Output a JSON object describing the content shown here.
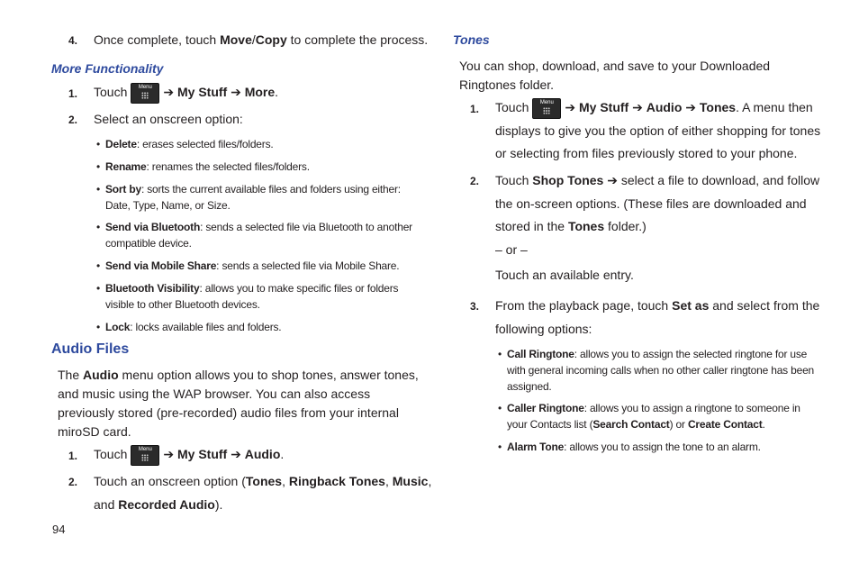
{
  "left": {
    "step4": {
      "num": "4.",
      "pre": "Once complete, touch ",
      "b1": "Move",
      "sep": "/",
      "b2": "Copy",
      "post": " to complete the process."
    },
    "more_heading": "More Functionality",
    "mf_step1": {
      "num": "1.",
      "pre": "Touch",
      "menu_label": "Menu",
      "arrow1": "➔ ",
      "b1": "My Stuff",
      "arrow2": " ➔ ",
      "b2": "More",
      "post": "."
    },
    "mf_step2": {
      "num": "2.",
      "text": "Select an onscreen option:"
    },
    "options": [
      {
        "name": "Delete",
        "desc": ": erases selected files/folders."
      },
      {
        "name": "Rename",
        "desc": ": renames the selected files/folders."
      },
      {
        "name": "Sort by",
        "desc": ": sorts the current available files and folders using either:",
        "desc2": "Date, Type, Name, or Size."
      },
      {
        "name": "Send via Bluetooth",
        "desc": ": sends a selected file via Bluetooth to another",
        "desc2": "compatible device."
      },
      {
        "name": "Send via Mobile Share",
        "desc": ": sends a selected file via Mobile Share."
      },
      {
        "name": "Bluetooth Visibility",
        "desc": ": allows you to make specific files or folders",
        "desc2": "visible to other Bluetooth devices."
      },
      {
        "name": "Lock",
        "desc": ": locks available files and folders."
      }
    ],
    "audio_heading": "Audio Files",
    "audio_para": {
      "pre": "The ",
      "b": "Audio",
      "l1": " menu option allows you to shop tones, answer tones,",
      "l2": "and music using the WAP browser. You can also access",
      "l3": "previously stored (pre-recorded) audio files from your internal",
      "l4": "miroSD card."
    },
    "af_step1": {
      "num": "1.",
      "pre": "Touch",
      "menu_label": "Menu",
      "arrow1": "➔ ",
      "b1": "My Stuff",
      "arrow2": " ➔ ",
      "b2": "Audio",
      "post": "."
    },
    "af_step2": {
      "num": "2.",
      "pre": "Touch an onscreen option (",
      "b1": "Tones",
      "c1": ", ",
      "b2": "Ringback Tones",
      "c2": ", ",
      "b3": "Music",
      "c3": ",",
      "l2pre": "and ",
      "b4": "Recorded Audio",
      "post": ")."
    }
  },
  "page_number": "94",
  "right": {
    "tones_heading": "Tones",
    "tones_para": {
      "l1": "You can shop, download, and save to your Downloaded",
      "l2": "Ringtones folder."
    },
    "t_step1": {
      "num": "1.",
      "pre": "Touch",
      "menu_label": "Menu",
      "arrow1": "➔ ",
      "b1": "My Stuff",
      "arrow2": " ➔ ",
      "b2": "Audio",
      "arrow3": " ➔ ",
      "b3": "Tones",
      "post": ". A menu then",
      "l2": "displays to give you the option of either shopping for tones",
      "l3": "or selecting from files previously stored to your phone."
    },
    "t_step2": {
      "num": "2.",
      "pre": "Touch ",
      "b1": "Shop Tones",
      "arrow": " ➔ ",
      "post": "select a file to download, and follow",
      "l2": "the on-screen options. (These files are downloaded and",
      "l3pre": "stored in the ",
      "b2": "Tones",
      "l3post": " folder.)",
      "or": "– or –",
      "alt": "Touch an available entry."
    },
    "t_step3": {
      "num": "3.",
      "pre": "From the playback page, touch ",
      "b1": "Set as",
      "post": " and select from the",
      "l2": "following options:"
    },
    "set_options": [
      {
        "name": "Call Ringtone",
        "desc": ": allows you to assign the selected ringtone for use",
        "desc2": "with general incoming calls when no other caller ringtone has been",
        "desc3": "assigned."
      },
      {
        "name": "Caller Ringtone",
        "desc": ": allows you to assign a ringtone to someone in",
        "desc2pre": "your Contacts list (",
        "b1": "Search Contact",
        "mid": ") or ",
        "b2": "Create Contact",
        "end": "."
      },
      {
        "name": "Alarm Tone",
        "desc": ": allows you to assign the tone to an alarm."
      }
    ]
  }
}
